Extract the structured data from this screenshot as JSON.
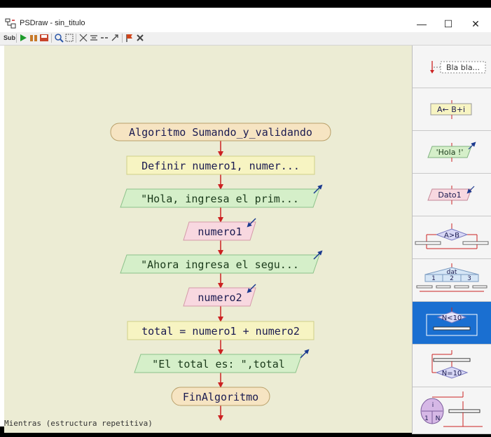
{
  "window": {
    "title": "PSDraw - sin_titulo",
    "minimize_glyph": "—",
    "maximize_glyph": "☐",
    "close_glyph": "✕"
  },
  "toolbar": {
    "items": [
      "Sub",
      "run-icon",
      "step-icon",
      "save-icon",
      "zoom-icon",
      "fit-icon",
      "arrange-icon",
      "align-icon",
      "line-icon",
      "tool-icon",
      "flag-icon",
      "delete-icon"
    ]
  },
  "flowchart": {
    "start": "Algoritmo Sumando_y_validando",
    "define": "Definir numero1, numer...",
    "output1": "\"Hola, ingresa el prim...",
    "input1": "numero1",
    "output2": "\"Ahora ingresa el segu...",
    "input2": "numero2",
    "assign": "total = numero1 + numero2",
    "output3": "\"El total es: \",total",
    "end": "FinAlgoritmo"
  },
  "status": "Mientras (estructura repetitiva)",
  "palette": {
    "comment": "Bla bla...",
    "assign": "A← B+i",
    "write": "'Hola !'",
    "read": "Dato1",
    "if": "A>B",
    "switch_label": "dat",
    "switch_cases": [
      "1",
      "2",
      "3"
    ],
    "while": "N<10",
    "repeat": "N=10",
    "for_i": "i",
    "for_from": "1",
    "for_to": "N"
  },
  "colors": {
    "canvas": "#ececd4",
    "start_end": "#f6e4c2",
    "define": "#f7f4c2",
    "output": "#d5efc9",
    "input": "#f8d8e0",
    "arrow": "#cc2222",
    "active_palette": "#1a6fd1"
  }
}
